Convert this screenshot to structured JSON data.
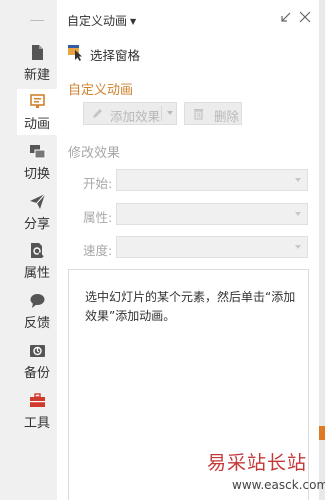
{
  "sidebar": {
    "items": [
      {
        "label": "新建",
        "icon": "new-file-icon",
        "active": false
      },
      {
        "label": "动画",
        "icon": "animation-icon",
        "active": true
      },
      {
        "label": "切换",
        "icon": "transition-icon",
        "active": false
      },
      {
        "label": "分享",
        "icon": "share-icon",
        "active": false
      },
      {
        "label": "属性",
        "icon": "properties-icon",
        "active": false
      },
      {
        "label": "反馈",
        "icon": "feedback-icon",
        "active": false
      },
      {
        "label": "备份",
        "icon": "backup-icon",
        "active": false
      },
      {
        "label": "工具",
        "icon": "toolbox-icon",
        "active": false
      }
    ]
  },
  "panel": {
    "title": "自定义动画",
    "select_pane_label": "选择窗格",
    "custom_animation_heading": "自定义动画",
    "add_effect_label": "添加效果",
    "delete_label": "删除",
    "modify_effect_heading": "修改效果",
    "fields": {
      "start_label": "开始:",
      "property_label": "属性:",
      "speed_label": "速度:"
    },
    "info_text": "选中幻灯片的某个元素，然后单击“添加效果”添加动画。"
  },
  "watermark": {
    "brand": "易采站长站",
    "url": "www.easck.com"
  },
  "colors": {
    "accent_orange": "#d0822f",
    "toolbox_red": "#d03a2c",
    "disabled_text": "#a8a8a8",
    "watermark_red": "#c43a3a"
  }
}
